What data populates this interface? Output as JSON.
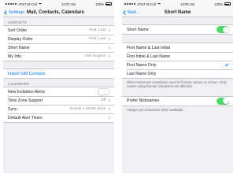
{
  "left": {
    "status": {
      "carrier": "AT&T M-Cell",
      "time": "10:07 AM",
      "battery": "100%"
    },
    "nav": {
      "back": "Settings",
      "title": "Mail, Contacts, Calendars"
    },
    "contacts_header": "CONTACTS",
    "contacts_rows": [
      {
        "label": "Sort Order",
        "value": "First, Last"
      },
      {
        "label": "Display Order",
        "value": "First, Last"
      },
      {
        "label": "Short Name",
        "value": ""
      },
      {
        "label": "My Info",
        "value": "Neil Hughes"
      }
    ],
    "import_sim": "Import SIM Contacts",
    "calendars_header": "CALENDARS",
    "calendar_rows": [
      {
        "label": "New Invitation Alerts",
        "value": "",
        "toggle": "off"
      },
      {
        "label": "Time Zone Support",
        "value": "Off"
      },
      {
        "label": "Sync",
        "value": "Events 1 Month Back"
      },
      {
        "label": "Default Alert Times",
        "value": ""
      }
    ]
  },
  "right": {
    "status": {
      "carrier": "AT&T M-Cell",
      "time": "10:08 AM",
      "battery": "100%"
    },
    "nav": {
      "back": "Mail...",
      "title": "Short Name"
    },
    "short_name_toggle": {
      "label": "Short Name",
      "state": "on"
    },
    "options": [
      {
        "label": "First Name & Last Initial",
        "selected": false
      },
      {
        "label": "First Initial & Last Name",
        "selected": false
      },
      {
        "label": "First Name Only",
        "selected": true
      },
      {
        "label": "Last Name Only",
        "selected": false
      }
    ],
    "options_footnote": "Short names are sometimes used to fit more names on screen. Only names using Roman characters are affected.",
    "prefer_nicknames": {
      "label": "Prefer Nicknames",
      "state": "on"
    },
    "nicknames_footnote": "Always use nicknames when available."
  },
  "colors": {
    "accent": "#007aff",
    "toggle_on": "#4cd964",
    "background": "#efeff4"
  }
}
